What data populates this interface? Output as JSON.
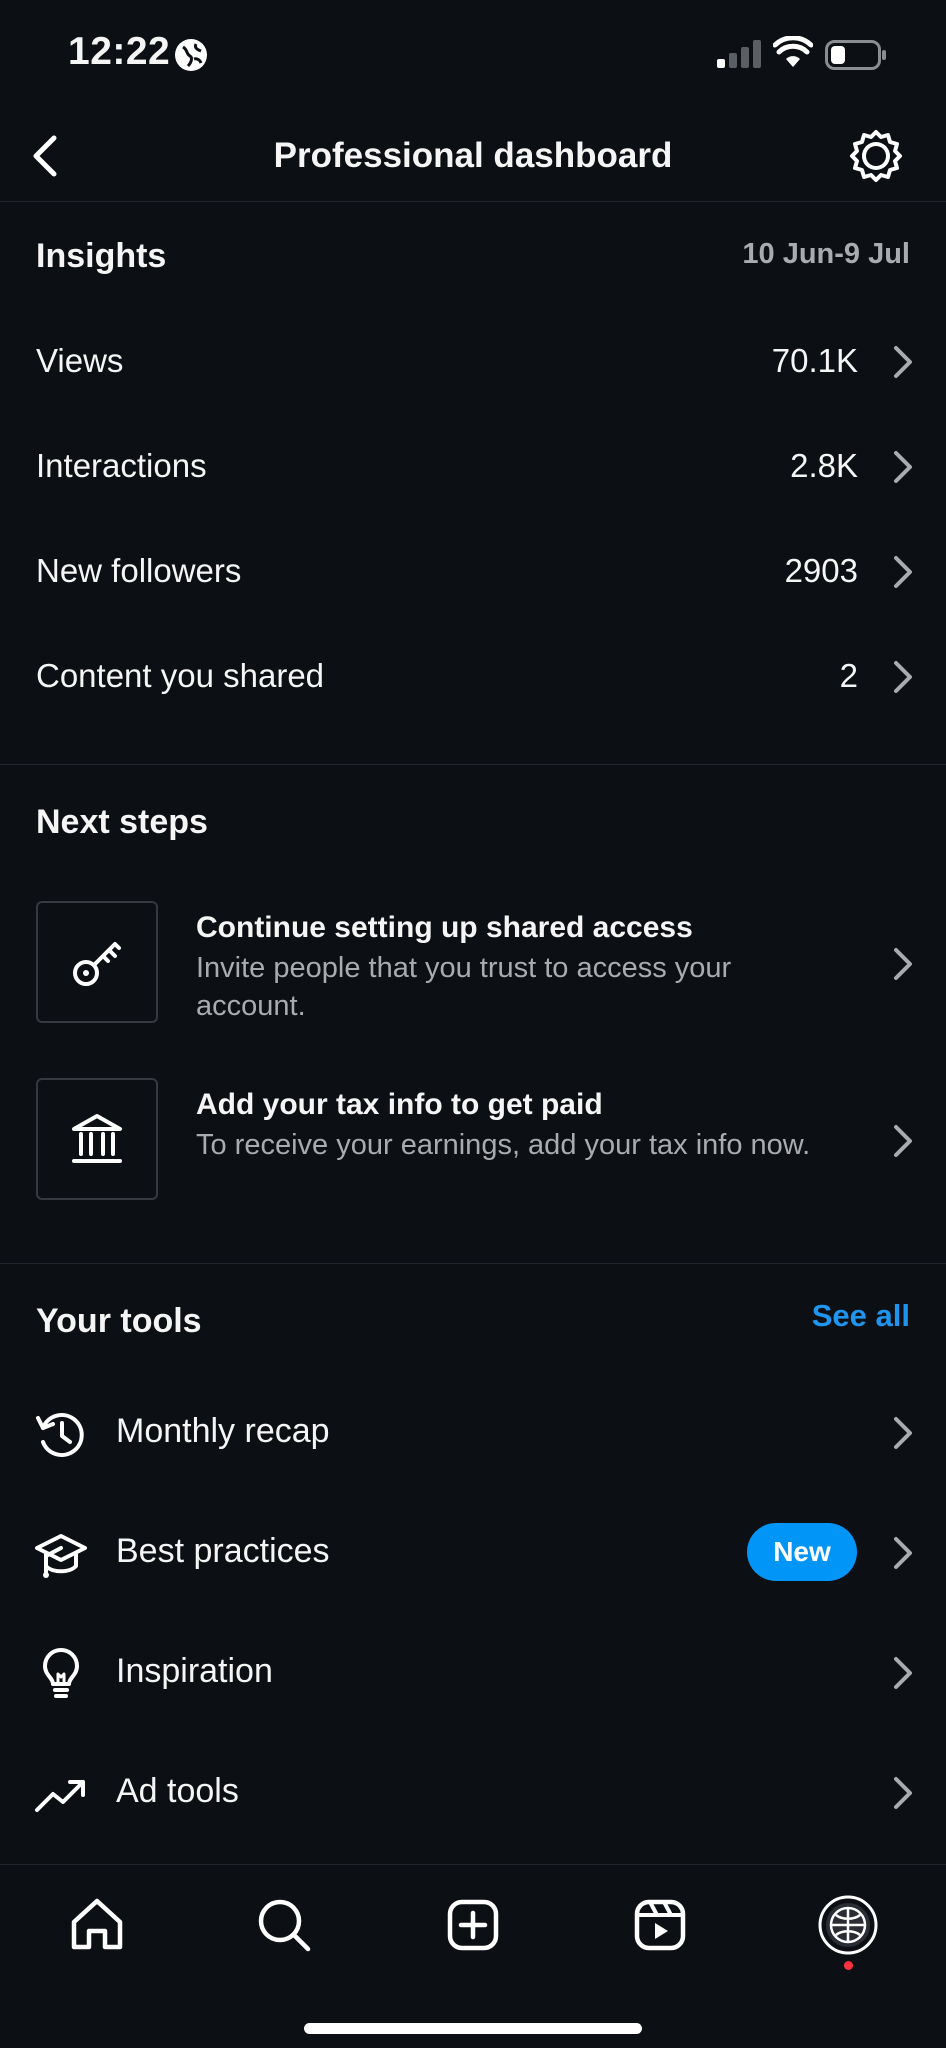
{
  "status_bar": {
    "time": "12:22"
  },
  "header": {
    "title": "Professional dashboard"
  },
  "insights": {
    "title": "Insights",
    "date_range": "10 Jun-9 Jul",
    "rows": [
      {
        "label": "Views",
        "value": "70.1K"
      },
      {
        "label": "Interactions",
        "value": "2.8K"
      },
      {
        "label": "New followers",
        "value": "2903"
      },
      {
        "label": "Content you shared",
        "value": "2"
      }
    ]
  },
  "next_steps": {
    "title": "Next steps",
    "items": [
      {
        "title": "Continue setting up shared access",
        "description": "Invite people that you trust to access your account.",
        "icon": "key-icon"
      },
      {
        "title": "Add your tax info to get paid",
        "description": "To receive your earnings, add your tax info now.",
        "icon": "bank-icon"
      }
    ]
  },
  "tools": {
    "title": "Your tools",
    "see_all": "See all",
    "items": [
      {
        "label": "Monthly recap",
        "icon": "history-icon"
      },
      {
        "label": "Best practices",
        "icon": "graduation-cap-icon",
        "badge": "New"
      },
      {
        "label": "Inspiration",
        "icon": "lightbulb-icon"
      },
      {
        "label": "Ad tools",
        "icon": "trending-up-icon"
      }
    ]
  },
  "bottom_nav": [
    "home-icon",
    "search-icon",
    "create-icon",
    "reels-icon",
    "profile-icon"
  ],
  "colors": {
    "background": "#0c1014",
    "accent": "#0095f6",
    "link": "#1e96f0",
    "secondary_text": "#a8abb0",
    "notification": "#ff3040"
  }
}
